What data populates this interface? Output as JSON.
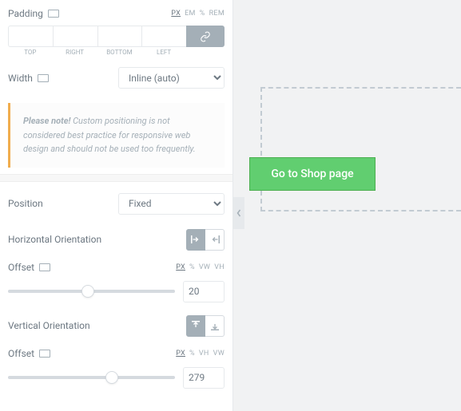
{
  "padding": {
    "label": "Padding",
    "units": [
      "PX",
      "EM",
      "%",
      "REM"
    ],
    "active_unit": "PX",
    "sides": {
      "top_label": "TOP",
      "right_label": "RIGHT",
      "bottom_label": "BOTTOM",
      "left_label": "LEFT"
    }
  },
  "width": {
    "label": "Width",
    "value": "Inline (auto)"
  },
  "notice": {
    "bold": "Please note!",
    "text": " Custom positioning is not considered best practice for responsive web design and should not be used too frequently."
  },
  "position": {
    "label": "Position",
    "value": "Fixed"
  },
  "h_orient": {
    "label": "Horizontal Orientation"
  },
  "h_offset": {
    "label": "Offset",
    "units": [
      "PX",
      "%",
      "VW",
      "VH"
    ],
    "active_unit": "PX",
    "value": "20",
    "thumb_pct": 48
  },
  "v_orient": {
    "label": "Vertical Orientation"
  },
  "v_offset": {
    "label": "Offset",
    "units": [
      "PX",
      "%",
      "VH",
      "VW"
    ],
    "active_unit": "PX",
    "value": "279",
    "thumb_pct": 62
  },
  "preview": {
    "button_label": "Go to Shop page"
  }
}
